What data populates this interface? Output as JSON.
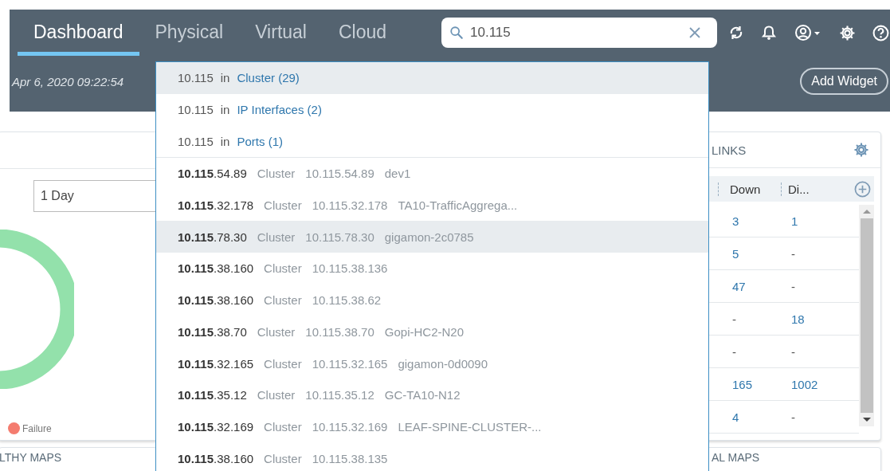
{
  "nav": {
    "tabs": [
      {
        "label": "Dashboard",
        "selected": true
      },
      {
        "label": "Physical",
        "selected": false
      },
      {
        "label": "Virtual",
        "selected": false
      },
      {
        "label": "Cloud",
        "selected": false
      }
    ]
  },
  "search": {
    "value": "10.115"
  },
  "subheader": {
    "timestamp": "Apr 6, 2020 09:22:54",
    "add_button": "Add Widget"
  },
  "suggestions": {
    "scopes": [
      {
        "query": "10.115",
        "word": "in",
        "target": "Cluster (29)",
        "selected": true
      },
      {
        "query": "10.115",
        "word": "in",
        "target": "IP Interfaces (2)",
        "selected": false
      },
      {
        "query": "10.115",
        "word": "in",
        "target": "Ports (1)",
        "selected": false
      }
    ],
    "results": [
      {
        "address": "**10.115**.54.89",
        "type": "Cluster",
        "cluster_ip": "10.115.54.89",
        "name": "dev1",
        "selected": false
      },
      {
        "address": "**10.115**.32.178",
        "type": "Cluster",
        "cluster_ip": "10.115.32.178",
        "name": "TA10-TrafficAggrega...",
        "selected": false
      },
      {
        "address": "**10.115**.78.30",
        "type": "Cluster",
        "cluster_ip": "10.115.78.30",
        "name": "gigamon-2c0785",
        "selected": true
      },
      {
        "address": "**10.115**.38.160",
        "type": "Cluster",
        "cluster_ip": "10.115.38.136",
        "selected": false
      },
      {
        "address": "**10.115**.38.160",
        "type": "Cluster",
        "cluster_ip": "10.115.38.62",
        "selected": false
      },
      {
        "address": "**10.115**.38.70",
        "type": "Cluster",
        "cluster_ip": "10.115.38.70",
        "name": "Gopi-HC2-N20",
        "selected": false
      },
      {
        "address": "**10.115**.32.165",
        "type": "Cluster",
        "cluster_ip": "10.115.32.165",
        "name": "gigamon-0d0090",
        "selected": false
      },
      {
        "address": "**10.115**.35.12",
        "type": "Cluster",
        "cluster_ip": "10.115.35.12",
        "name": "GC-TA10-N12",
        "selected": false
      },
      {
        "address": "**10.115**.32.169",
        "type": "Cluster",
        "cluster_ip": "10.115.32.169",
        "name": "LEAF-SPINE-CLUSTER-...",
        "selected": false
      },
      {
        "address": "**10.115**.38.160",
        "type": "Cluster",
        "cluster_ip": "10.115.38.135",
        "selected": false
      }
    ]
  },
  "left_card": {
    "period": "1 Day",
    "legend": [
      {
        "label": "Failure",
        "color": "#f47c6f"
      }
    ],
    "footer_title": "LTHY MAPS"
  },
  "right_card": {
    "title": "LINKS",
    "columns": [
      "Down",
      "Di..."
    ],
    "rows": [
      [
        {
          "text": "3",
          "kind": "link"
        },
        {
          "text": "1",
          "kind": "link"
        }
      ],
      [
        {
          "text": "5",
          "kind": "link"
        },
        {
          "text": "-",
          "kind": "empty"
        }
      ],
      [
        {
          "text": "47",
          "kind": "link"
        },
        {
          "text": "-",
          "kind": "empty"
        }
      ],
      [
        {
          "text": "-",
          "kind": "empty"
        },
        {
          "text": "18",
          "kind": "link"
        }
      ],
      [
        {
          "text": "-",
          "kind": "empty"
        },
        {
          "text": "-",
          "kind": "empty"
        }
      ],
      [
        {
          "text": "165",
          "kind": "link"
        },
        {
          "text": "1002",
          "kind": "link"
        }
      ],
      [
        {
          "text": "4",
          "kind": "link"
        },
        {
          "text": "-",
          "kind": "empty"
        }
      ]
    ],
    "footer_title": "AL MAPS"
  }
}
